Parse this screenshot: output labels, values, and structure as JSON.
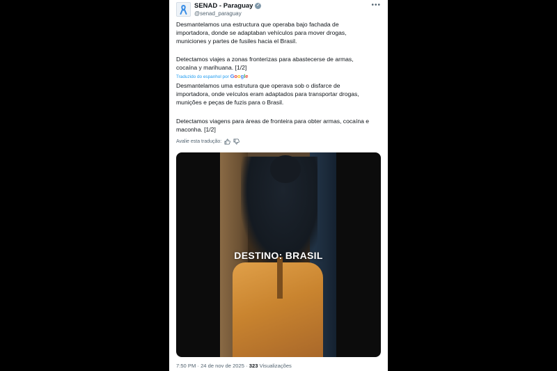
{
  "account": {
    "name": "SENAD - Paraguay",
    "handle": "@senad_paraguay"
  },
  "tweet": {
    "spanish_p1": "Desmantelamos una estructura que operaba bajo fachada de\nimportadora, donde se adaptaban vehículos para mover drogas,\nmuniciones y partes de fusiles hacia el Brasil.",
    "spanish_p2": "Detectamos viajes a zonas fronterizas para abastecerse de armas,\ncocaína y marihuana. [1/2]",
    "translated_label": "Traduzido do espanhol por",
    "google": {
      "g1": "G",
      "o1": "o",
      "o2": "o",
      "g2": "g",
      "l": "l",
      "e": "e"
    },
    "portuguese_p1": "Desmantelamos uma estrutura que operava sob o disfarce de\nimportadora, onde veículos eram adaptados para transportar drogas,\nmunições e peças de fuzis para o Brasil.",
    "portuguese_p2": "Detectamos viagens para áreas de fronteira para obter armas, cocaína e\nmaconha. [1/2]",
    "rate_label": "Avalie esta tradução:"
  },
  "media": {
    "overlay_text": "DESTINO: BRASIL"
  },
  "meta": {
    "time": "7:50 PM",
    "date": "24 de nov de 2025",
    "views_count": "323",
    "views_label": "Visualizações",
    "separator": "·"
  },
  "icons": {
    "avatar": "ribbon-icon",
    "verified": "verified-badge-icon",
    "more": "more-icon",
    "thumbs_up": "thumbs-up-icon",
    "thumbs_down": "thumbs-down-icon"
  },
  "colors": {
    "link": "#1d9bf0",
    "text": "#0f1419",
    "muted": "#536471",
    "ribbon": "#3a8ee6"
  }
}
